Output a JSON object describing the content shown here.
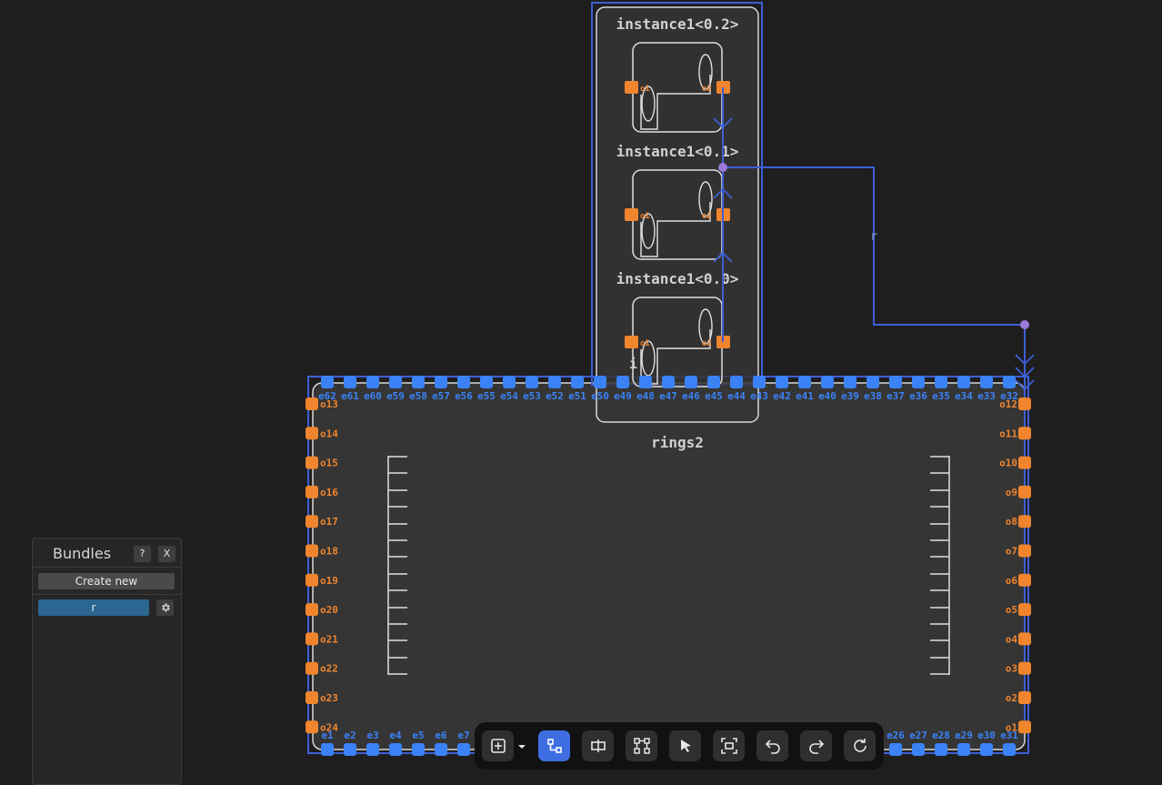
{
  "canvas": {
    "instances": [
      {
        "label": "instance1<0.2>",
        "left_port": "o1",
        "right_port": "o2"
      },
      {
        "label": "instance1<0.1>",
        "left_port": "o1",
        "right_port": "o2"
      },
      {
        "label": "instance1<0.0>",
        "left_port": "o1",
        "right_port": "o2"
      }
    ],
    "partial_label": "i",
    "container_label": "rings2",
    "wire_label": "r",
    "top_ports": [
      "e62",
      "e61",
      "e60",
      "e59",
      "e58",
      "e57",
      "e56",
      "e55",
      "e54",
      "e53",
      "e52",
      "e51",
      "e50",
      "e49",
      "e48",
      "e47",
      "e46",
      "e45",
      "e44",
      "e43",
      "e42",
      "e41",
      "e40",
      "e39",
      "e38",
      "e37",
      "e36",
      "e35",
      "e34",
      "e33",
      "e32"
    ],
    "bottom_ports_left": [
      "e1",
      "e2",
      "e3",
      "e4",
      "e5",
      "e6",
      "e7"
    ],
    "bottom_ports_right": [
      "e26",
      "e27",
      "e28",
      "e29",
      "e30",
      "e31"
    ],
    "left_ports": [
      "o13",
      "o14",
      "o15",
      "o16",
      "o17",
      "o18",
      "o19",
      "o20",
      "o21",
      "o22",
      "o23",
      "o24"
    ],
    "right_ports": [
      "o12",
      "o11",
      "o10",
      "o9",
      "o8",
      "o7",
      "o6",
      "o5",
      "o4",
      "o3",
      "o2",
      "o1"
    ],
    "colors": {
      "background": "#1e1e1e",
      "box": "#353535",
      "blue": "#3b82f6",
      "orange": "#f0852d",
      "wire": "#3d5fd6",
      "node": "#9a79d8"
    }
  },
  "bundles": {
    "title": "Bundles",
    "help_label": "?",
    "close_label": "X",
    "create_label": "Create new",
    "items": [
      {
        "name": "r",
        "icon": "gear-icon"
      }
    ]
  },
  "toolbar": {
    "buttons": [
      {
        "name": "add-icon"
      },
      {
        "name": "chevron-down-icon"
      },
      {
        "name": "connect-icon",
        "active": true
      },
      {
        "name": "split-icon"
      },
      {
        "name": "route-icon"
      },
      {
        "name": "pointer-icon"
      },
      {
        "name": "fit-view-icon"
      },
      {
        "name": "undo-icon"
      },
      {
        "name": "redo-icon"
      },
      {
        "name": "refresh-icon"
      }
    ]
  }
}
